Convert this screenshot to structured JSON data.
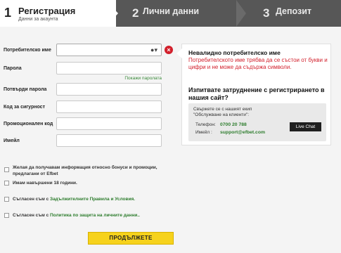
{
  "steps": [
    {
      "num": "1",
      "title": "Регистрация",
      "subtitle": "Данни за акаунта"
    },
    {
      "num": "2",
      "title": "Лични данни"
    },
    {
      "num": "3",
      "title": "Депозит"
    }
  ],
  "form": {
    "username_label": "Потребителско име",
    "username_value": "",
    "password_label": "Парола",
    "show_password": "Покажи паролата",
    "confirm_label": "Потвърди парола",
    "security_label": "Код за сигурност",
    "promo_label": "Промоционален код",
    "email_label": "Имейл",
    "checkboxes": [
      "Желая да получавам информация относно бонуси и промоции, предлагани от Efbet",
      "Имам навършени 18 години.",
      "Съгласен съм с ",
      "Съгласен съм с "
    ],
    "terms_link": "Задължителните Правила и Условия.",
    "privacy_link": "Политика по защита на личните данни..",
    "submit": "ПРОДЪЛЖЕТЕ"
  },
  "error": {
    "title": "Невалидно потребителско име",
    "message": "Потребителското име трябва да се състои от букви и цифри и не може да съдържа символи."
  },
  "help": {
    "title": "Изпитвате затруднение с регистрирането в нашия сайт?",
    "contact_text": "Свържете се с нашият екип \"Обслужване на клиенти\":",
    "phone_label": "Телефон:",
    "phone": "0700 20 788",
    "email_label": "Имейл :",
    "email": "support@efbet.com",
    "chat_button": "Live Chat"
  },
  "colors": {
    "accent": "#f6d21c",
    "error": "#d21f2b",
    "link": "#2e7d2e"
  }
}
